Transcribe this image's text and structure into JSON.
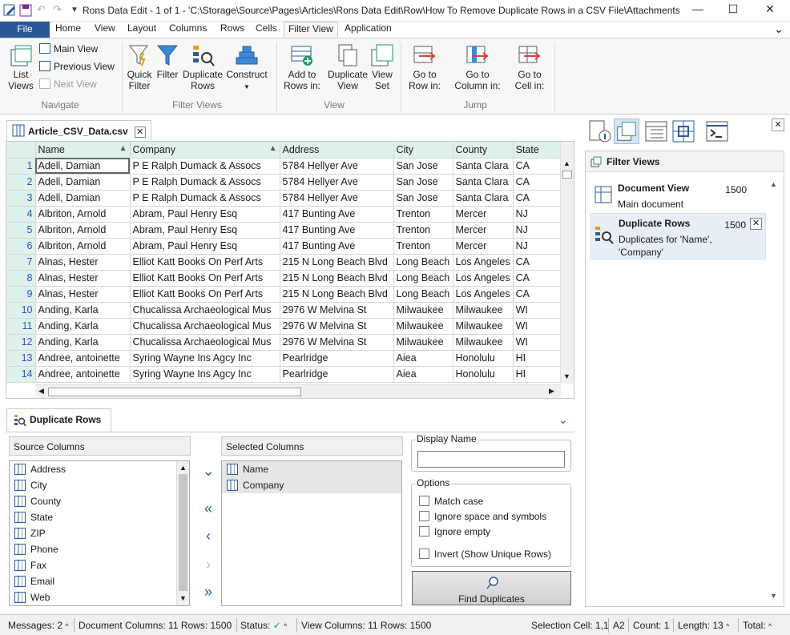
{
  "window": {
    "title": "Rons Data Edit - 1 of 1 - 'C:\\Storage\\Source\\Pages\\Articles\\Rons Data Edit\\Row\\How To Remove Duplicate Rows in a CSV File\\Attachments\\..."
  },
  "ribbon": {
    "file_tab": "File",
    "tabs": [
      "Home",
      "View",
      "Layout",
      "Columns",
      "Rows",
      "Cells",
      "Filter View",
      "Application"
    ],
    "active_tab": "Filter View",
    "navigate": {
      "list_views": "List Views",
      "main_view": "Main View",
      "previous_view": "Previous View",
      "next_view": "Next View",
      "group": "Navigate"
    },
    "filter_views": {
      "quick_filter": "Quick Filter",
      "filter": "Filter",
      "duplicate_rows": "Duplicate Rows",
      "construct": "Construct",
      "group": "Filter Views"
    },
    "view": {
      "add_to_rows_in": "Add to Rows in:",
      "duplicate_view": "Duplicate View",
      "view_set": "View Set",
      "group": "View"
    },
    "jump": {
      "goto_row": "Go to Row in:",
      "goto_column": "Go to Column in:",
      "goto_cell": "Go to Cell in:",
      "group": "Jump"
    }
  },
  "document": {
    "tab_name": "Article_CSV_Data.csv",
    "columns": [
      "Name",
      "Company",
      "Address",
      "City",
      "County",
      "State"
    ],
    "rows": [
      [
        "1",
        "Adell, Damian",
        "P E Ralph Dumack & Assocs",
        "5784 Hellyer Ave",
        "San Jose",
        "Santa Clara",
        "CA"
      ],
      [
        "2",
        "Adell, Damian",
        "P E Ralph Dumack & Assocs",
        "5784 Hellyer Ave",
        "San Jose",
        "Santa Clara",
        "CA"
      ],
      [
        "3",
        "Adell, Damian",
        "P E Ralph Dumack & Assocs",
        "5784 Hellyer Ave",
        "San Jose",
        "Santa Clara",
        "CA"
      ],
      [
        "4",
        "Albriton, Arnold",
        "Abram, Paul Henry Esq",
        "417 Bunting Ave",
        "Trenton",
        "Mercer",
        "NJ"
      ],
      [
        "5",
        "Albriton, Arnold",
        "Abram, Paul Henry Esq",
        "417 Bunting Ave",
        "Trenton",
        "Mercer",
        "NJ"
      ],
      [
        "6",
        "Albriton, Arnold",
        "Abram, Paul Henry Esq",
        "417 Bunting Ave",
        "Trenton",
        "Mercer",
        "NJ"
      ],
      [
        "7",
        "Alnas, Hester",
        "Elliot Katt Books On Perf Arts",
        "215 N Long Beach Blvd",
        "Long Beach",
        "Los Angeles",
        "CA"
      ],
      [
        "8",
        "Alnas, Hester",
        "Elliot Katt Books On Perf Arts",
        "215 N Long Beach Blvd",
        "Long Beach",
        "Los Angeles",
        "CA"
      ],
      [
        "9",
        "Alnas, Hester",
        "Elliot Katt Books On Perf Arts",
        "215 N Long Beach Blvd",
        "Long Beach",
        "Los Angeles",
        "CA"
      ],
      [
        "10",
        "Anding, Karla",
        "Chucalissa Archaeological Mus",
        "2976 W Melvina St",
        "Milwaukee",
        "Milwaukee",
        "WI"
      ],
      [
        "11",
        "Anding, Karla",
        "Chucalissa Archaeological Mus",
        "2976 W Melvina St",
        "Milwaukee",
        "Milwaukee",
        "WI"
      ],
      [
        "12",
        "Anding, Karla",
        "Chucalissa Archaeological Mus",
        "2976 W Melvina St",
        "Milwaukee",
        "Milwaukee",
        "WI"
      ],
      [
        "13",
        "Andree, antoinette",
        "Syring Wayne Ins Agcy Inc",
        "Pearlridge",
        "Aiea",
        "Honolulu",
        "HI"
      ],
      [
        "14",
        "Andree, antoinette",
        "Syring Wayne Ins Agcy Inc",
        "Pearlridge",
        "Aiea",
        "Honolulu",
        "HI"
      ]
    ]
  },
  "filter_views_panel": {
    "title": "Filter Views",
    "items": [
      {
        "title": "Document View",
        "count": "1500",
        "desc": "Main document"
      },
      {
        "title": "Duplicate Rows",
        "count": "1500",
        "desc": "Duplicates for 'Name', 'Company'"
      }
    ]
  },
  "duplicate_panel": {
    "tab": "Duplicate Rows",
    "source_header": "Source Columns",
    "source_columns": [
      "Address",
      "City",
      "County",
      "State",
      "ZIP",
      "Phone",
      "Fax",
      "Email",
      "Web"
    ],
    "selected_header": "Selected Columns",
    "selected_columns": [
      "Name",
      "Company"
    ],
    "display_name_label": "Display Name",
    "display_name_value": "",
    "options_label": "Options",
    "options": [
      "Match case",
      "Ignore space and symbols",
      "Ignore empty",
      "Invert (Show Unique Rows)"
    ],
    "find_button": "Find Duplicates"
  },
  "status": {
    "messages": "Messages: 2",
    "document": "Document Columns: 11 Rows: 1500",
    "status_label": "Status:",
    "view": "View Columns: 11 Rows: 1500",
    "selection": "Selection Cell: 1,1",
    "cell": "A2",
    "count": "Count: 1",
    "length": "Length: 13",
    "total": "Total:"
  },
  "colors": {
    "accent": "#2b579a",
    "grid_header": "#dff1ec",
    "row_number": "#2a55b8"
  }
}
